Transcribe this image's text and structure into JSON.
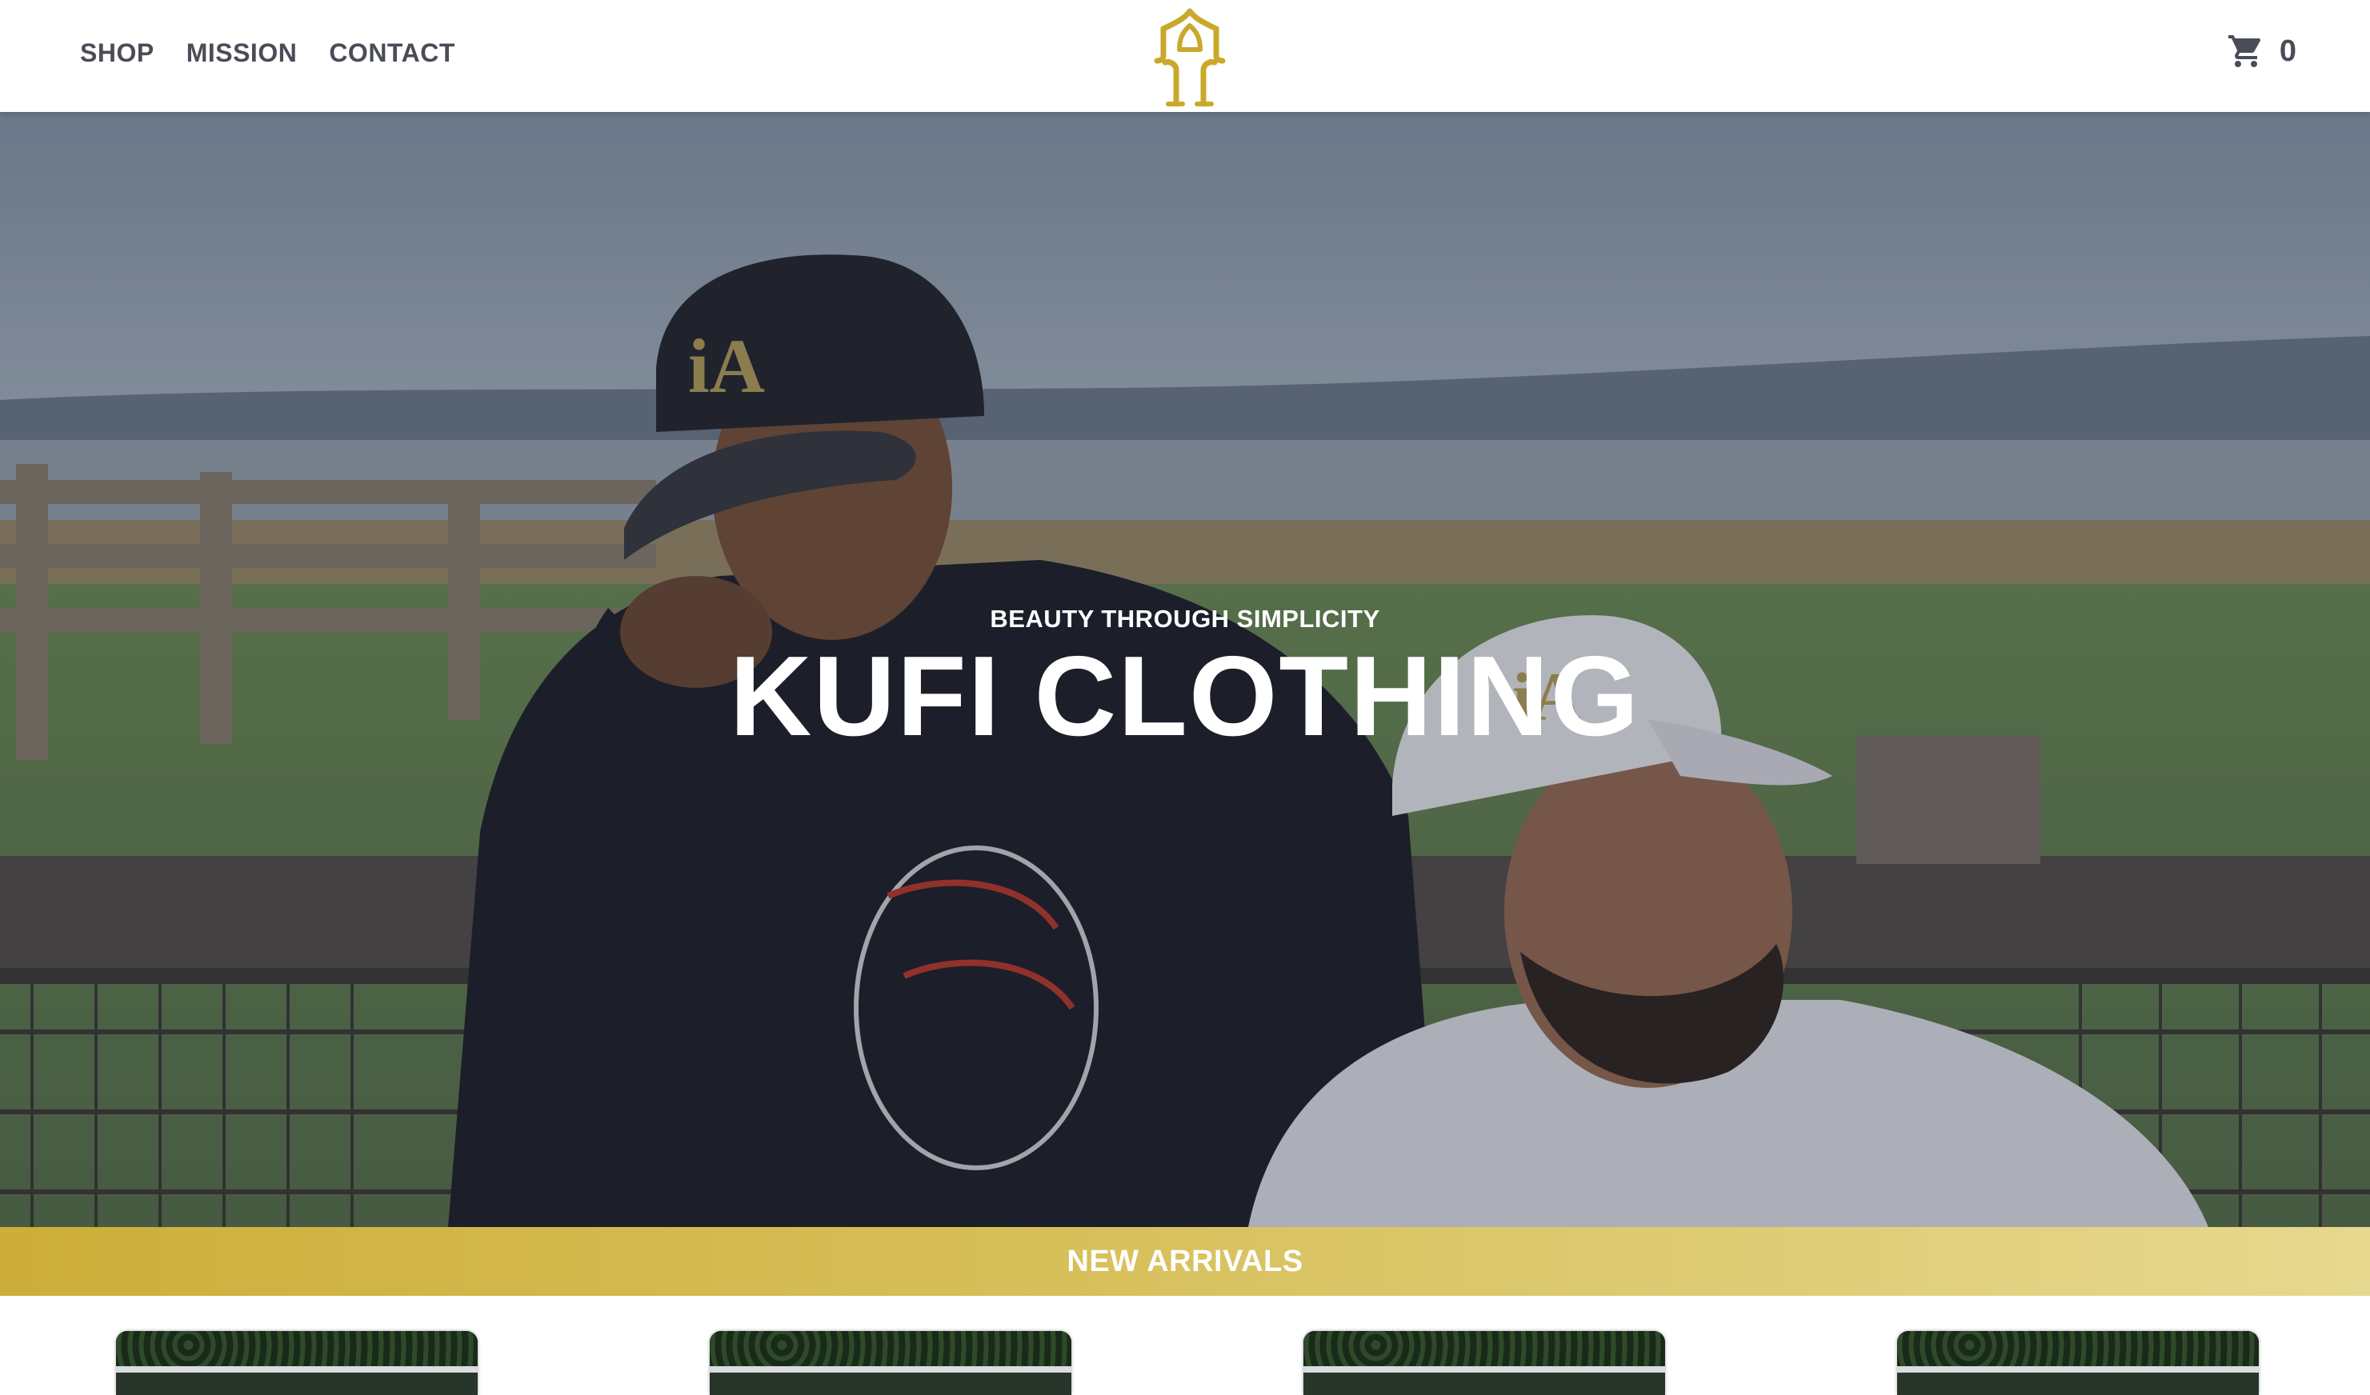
{
  "nav": {
    "items": [
      "SHOP",
      "MISSION",
      "CONTACT"
    ]
  },
  "logo": {
    "icon": "arch-logo-icon",
    "color": "#c9a92b"
  },
  "cart": {
    "icon": "shopping-cart-icon",
    "count": "0"
  },
  "hero": {
    "subtitle": "BEAUTY THROUGH SIMPLICITY",
    "title": "KUFI CLOTHING"
  },
  "arrivals": {
    "label": "NEW ARRIVALS",
    "colors": {
      "start": "#cdae3a",
      "end": "#e6d88e"
    }
  },
  "colors": {
    "nav_text": "#4a4d57",
    "accent_gold": "#c9a92b"
  }
}
